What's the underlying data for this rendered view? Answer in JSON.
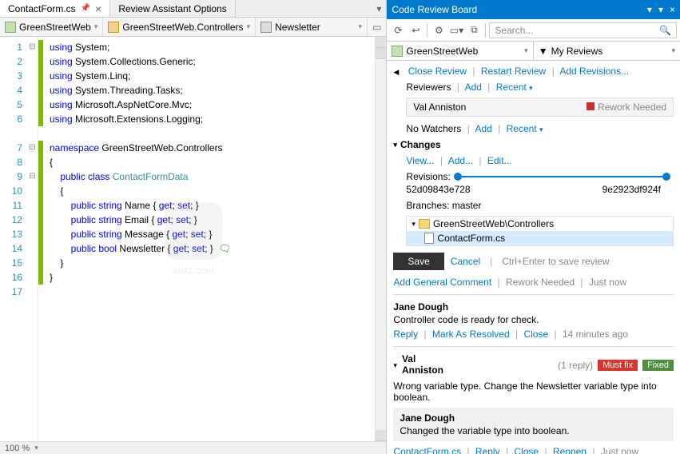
{
  "tabs": {
    "file": "ContactForm.cs",
    "options": "Review Assistant Options"
  },
  "breadcrumb": {
    "project": "GreenStreetWeb",
    "class": "GreenStreetWeb.Controllers",
    "member": "Newsletter"
  },
  "code": {
    "lines": [
      "1",
      "2",
      "3",
      "4",
      "5",
      "6",
      "7",
      "8",
      "9",
      "10",
      "11",
      "12",
      "13",
      "14",
      "15",
      "16",
      "17"
    ],
    "l1_a": "using",
    "l1_b": " System;",
    "l2_a": "using",
    "l2_b": " System.Collections.Generic;",
    "l3_a": "using",
    "l3_b": " System.Linq;",
    "l4_a": "using",
    "l4_b": " System.Threading.Tasks;",
    "l5_a": "using",
    "l5_b": " Microsoft.AspNetCore.Mvc;",
    "l6_a": "using",
    "l6_b": " Microsoft.Extensions.Logging;",
    "l8_a": "namespace",
    "l8_b": " GreenStreetWeb.Controllers",
    "l9": "{",
    "l10_a": "    public",
    "l10_b": " class",
    "l10_c": " ContactFormData",
    "l11": "    {",
    "l12_a": "        public",
    "l12_b": " string",
    "l12_c": " Name { ",
    "l12_d": "get",
    "l12_e": "; ",
    "l12_f": "set",
    "l12_g": "; }",
    "l13_a": "        public",
    "l13_b": " string",
    "l13_c": " Email { ",
    "l13_d": "get",
    "l13_e": "; ",
    "l13_f": "set",
    "l13_g": "; }",
    "l14_a": "        public",
    "l14_b": " string",
    "l14_c": " Message { ",
    "l14_d": "get",
    "l14_e": "; ",
    "l14_f": "set",
    "l14_g": "; }",
    "l15_a": "        public",
    "l15_b": " bool",
    "l15_c": " Newsletter { ",
    "l15_d": "get",
    "l15_e": "; ",
    "l15_f": "set",
    "l15_g": "; }",
    "l16": "    }",
    "l17": "}"
  },
  "zoom": "100 %",
  "watermark": "anxz.com",
  "panel": {
    "title": "Code Review Board",
    "search_placeholder": "Search...",
    "project": "GreenStreetWeb",
    "filter": "My Reviews",
    "close_review": "Close Review",
    "restart_review": "Restart Review",
    "add_revisions": "Add Revisions...",
    "reviewers_label": "Reviewers",
    "add": "Add",
    "recent": "Recent",
    "reviewer_name": "Val Anniston",
    "reviewer_status": "Rework Needed",
    "no_watchers": "No Watchers",
    "changes": "Changes",
    "view": "View...",
    "add2": "Add...",
    "edit": "Edit...",
    "revisions_label": "Revisions:",
    "rev_left": "52d09843e728",
    "rev_right": "9e2923df924f",
    "branches_label": "Branches:",
    "branch": "master",
    "tree_folder": "GreenStreetWeb\\Controllers",
    "tree_file": "ContactForm.cs",
    "save": "Save",
    "cancel": "Cancel",
    "save_hint": "Ctrl+Enter to save review",
    "add_general": "Add General Comment",
    "rework_needed": "Rework Needed",
    "just_now": "Just now",
    "c1_author": "Jane Dough",
    "c1_body": "Controller code is ready for check.",
    "reply": "Reply",
    "mark_resolved": "Mark As Resolved",
    "close": "Close",
    "c1_time": "14 minutes ago",
    "c2_author": "Val Anniston",
    "c2_replies": "(1 reply)",
    "c2_badge1": "Must fix",
    "c2_badge2": "Fixed",
    "c2_body": "Wrong variable type. Change the Newsletter variable type into boolean.",
    "c2r_author": "Jane Dough",
    "c2r_body": "Changed the variable type into boolean.",
    "c2_file": "ContactForm.cs",
    "reopen": "Reopen"
  }
}
